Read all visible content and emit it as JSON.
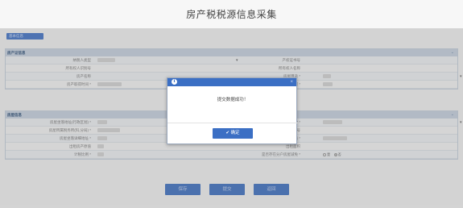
{
  "header": {
    "title": "房产税税源信息采集"
  },
  "tabs": {
    "basic": "基本信息"
  },
  "sections": {
    "property_cert": {
      "title": "房产证信息",
      "rows": [
        {
          "left_label": "纳税人类型",
          "right_label": "产权证书号"
        },
        {
          "left_label": "所有权人识别号",
          "right_label": "所有权人名称"
        },
        {
          "left_label": "房产名称",
          "right_label": "房屋用途 *"
        },
        {
          "left_label": "房产取得时间 *",
          "right_label": "建筑面积 *"
        }
      ]
    },
    "house_info": {
      "title": "房屋信息",
      "rows": [
        {
          "left_label": "房屋坐落地址(行政区划) *",
          "right_label": "房屋坐落(县(区)) *"
        },
        {
          "left_label": "房屋所属税务所(科,分局) *",
          "right_label": "房屋坐落编号"
        },
        {
          "left_label": "房屋坐落详细地址 *",
          "right_label": "房产原值 *"
        },
        {
          "left_label": "出租房产原值",
          "right_label": "出租面积"
        },
        {
          "left_label": "计税比例 *",
          "right_label": "是否存在分户房屋减免 *"
        }
      ],
      "radio_yes": "是",
      "radio_no": "否"
    }
  },
  "actions": {
    "save": "保存",
    "submit": "提交",
    "back": "返回"
  },
  "dialog": {
    "icon": "i",
    "close": "×",
    "message": "提交数据成功！",
    "ok_label": "✔ 确定"
  },
  "colors": {
    "accent": "#3b6fc4",
    "section_header": "#c9d5e3"
  }
}
